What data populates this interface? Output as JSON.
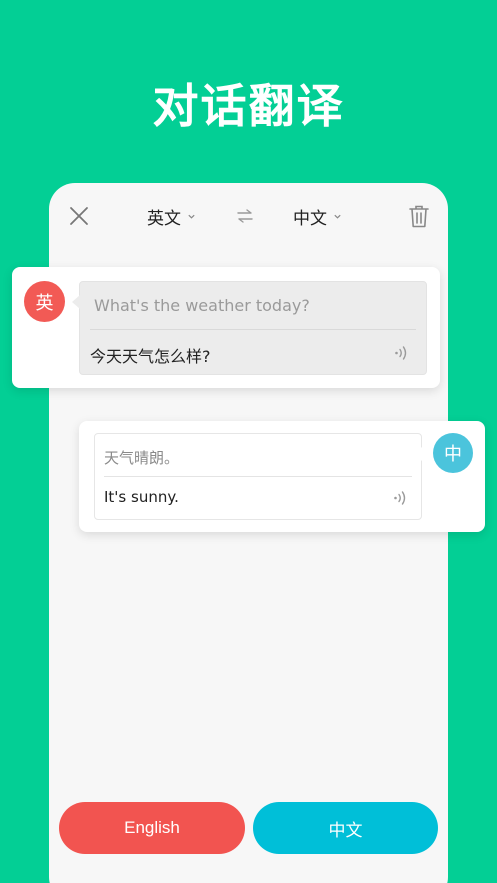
{
  "headline": "对话翻译",
  "toolbar": {
    "close_icon": "close-icon",
    "source_lang": "英文",
    "target_lang": "中文",
    "swap_icon": "swap-arrows-icon",
    "trash_icon": "trash-icon"
  },
  "messages": [
    {
      "speaker_badge": "英",
      "source_text": "What's the weather today?",
      "translation": "今天天气怎么样?",
      "badge_color": "#f25a55"
    },
    {
      "speaker_badge": "中",
      "source_text": "天气晴朗。",
      "translation": "It's sunny.",
      "badge_color": "#4bc4dc"
    }
  ],
  "buttons": {
    "english_label": "English",
    "chinese_label": "中文",
    "english_color": "#f25450",
    "chinese_color": "#00bfd8"
  },
  "colors": {
    "background": "#03cf95",
    "panel": "#f7f7f7"
  }
}
